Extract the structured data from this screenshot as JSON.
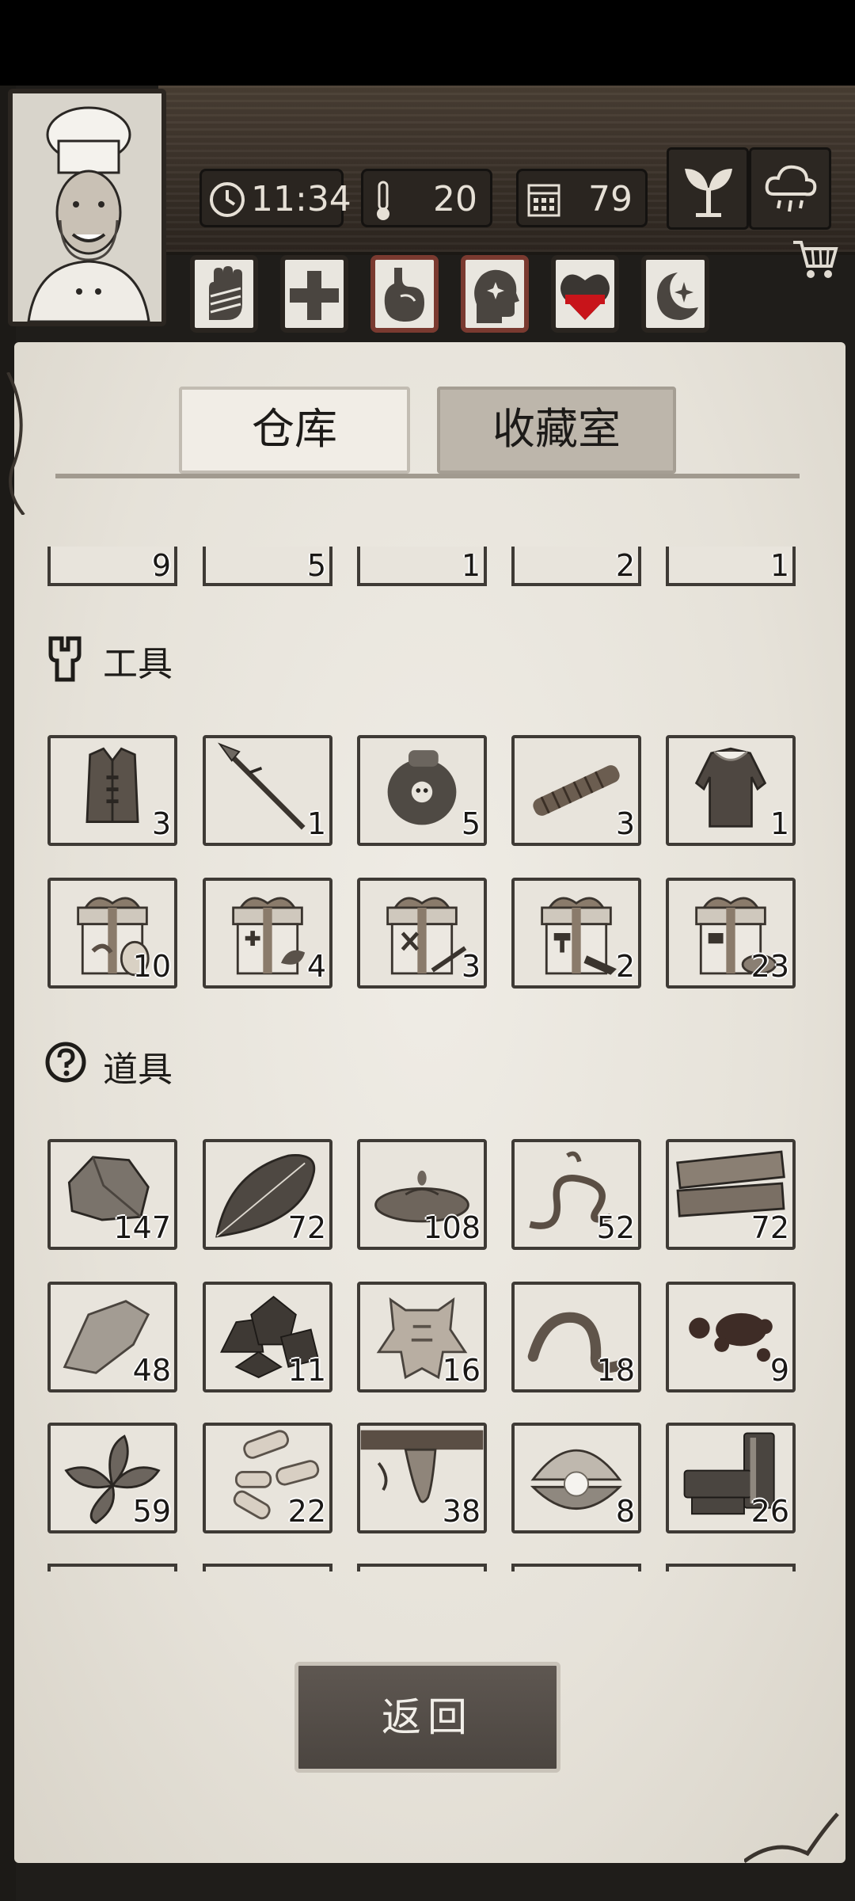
{
  "status_bar": {
    "time": "11:34",
    "temperature": "20",
    "day": "79"
  },
  "tabs": [
    {
      "label": "仓库",
      "active": true
    },
    {
      "label": "收藏室",
      "active": false
    }
  ],
  "top_partial_counts": [
    "9",
    "5",
    "1",
    "2",
    "1"
  ],
  "sections": {
    "tools": {
      "title": "工具",
      "icon": "wrench-icon",
      "items": [
        {
          "icon": "vest-icon",
          "count": "3"
        },
        {
          "icon": "spear-icon",
          "count": "1"
        },
        {
          "icon": "poison-jar-icon",
          "count": "5"
        },
        {
          "icon": "rope-torch-icon",
          "count": "3"
        },
        {
          "icon": "fur-coat-icon",
          "count": "1"
        },
        {
          "icon": "gift-box-food-icon",
          "count": "10"
        },
        {
          "icon": "gift-box-medical-icon",
          "count": "4"
        },
        {
          "icon": "gift-box-weapons-icon",
          "count": "3"
        },
        {
          "icon": "gift-box-tools-icon",
          "count": "2"
        },
        {
          "icon": "gift-box-materials-icon",
          "count": "23"
        }
      ]
    },
    "props": {
      "title": "道具",
      "icon": "question-circle-icon",
      "items": [
        {
          "icon": "stone-icon",
          "count": "147"
        },
        {
          "icon": "leaf-icon",
          "count": "72"
        },
        {
          "icon": "water-puddle-icon",
          "count": "108"
        },
        {
          "icon": "vine-icon",
          "count": "52"
        },
        {
          "icon": "wood-planks-icon",
          "count": "72"
        },
        {
          "icon": "flint-icon",
          "count": "48"
        },
        {
          "icon": "ore-icon",
          "count": "11"
        },
        {
          "icon": "animal-hide-icon",
          "count": "16"
        },
        {
          "icon": "worm-icon",
          "count": "18"
        },
        {
          "icon": "blood-drops-icon",
          "count": "9"
        },
        {
          "icon": "herb-icon",
          "count": "59"
        },
        {
          "icon": "bone-fragments-icon",
          "count": "22"
        },
        {
          "icon": "resin-icon",
          "count": "38"
        },
        {
          "icon": "pearl-shell-icon",
          "count": "8"
        },
        {
          "icon": "metal-scrap-icon",
          "count": "26"
        }
      ]
    }
  },
  "back_button": "返回",
  "colors": {
    "paper": "#e8e4dc",
    "slot_border": "#3e3a35",
    "wood": "#3a3129",
    "heart_red": "#c8141a"
  }
}
